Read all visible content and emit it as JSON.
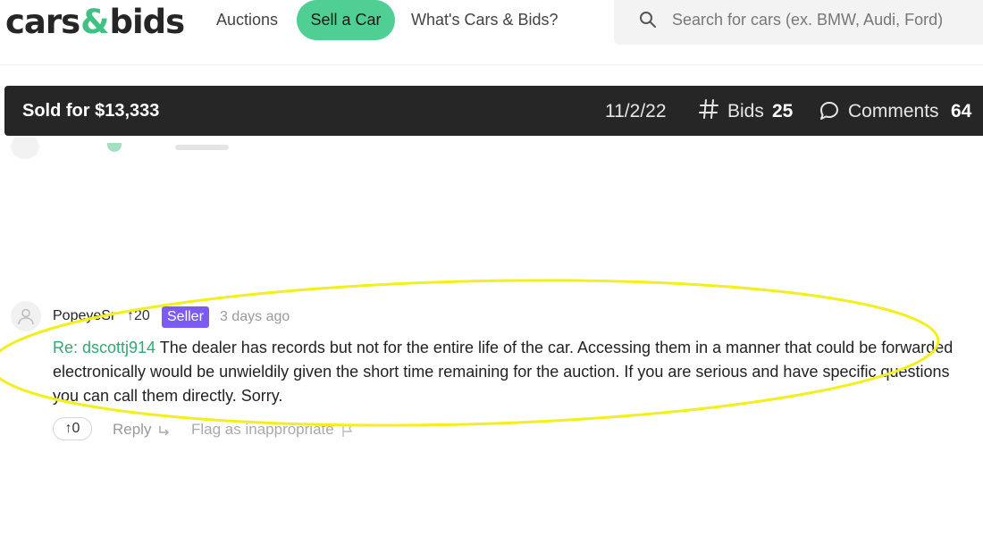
{
  "header": {
    "logo": {
      "left": "cars",
      "amp": "&",
      "right": "bids"
    },
    "nav": {
      "auctions": "Auctions",
      "sell": "Sell a Car",
      "whats": "What's Cars & Bids?"
    },
    "search": {
      "placeholder": "Search for cars (ex. BMW, Audi, Ford)"
    }
  },
  "auction_bar": {
    "sold": "Sold for $13,333",
    "date": "11/2/22",
    "bids_label": "Bids",
    "bids_count": "25",
    "comments_label": "Comments",
    "comments_count": "64"
  },
  "comment": {
    "username": "PopeyeSr",
    "reputation": "↑20",
    "badge": "Seller",
    "time": "3 days ago",
    "reply_to": "Re: dscottj914",
    "text": " The dealer has records but not for the entire life of the car. Accessing them in a manner that could be forwarded electronically would be unwieldily given the short time remaining for the auction. If you are serious and have specific questions you can call them directly. Sorry.",
    "votes": "↑0",
    "reply_label": "Reply",
    "flag_label": "Flag as inappropriate"
  },
  "colors": {
    "accent_green": "#4fcf93",
    "link_green": "#33a873",
    "seller_purple": "#7b5bf0",
    "bar_dark": "#262626",
    "highlight_yellow": "#f3ef1a"
  }
}
